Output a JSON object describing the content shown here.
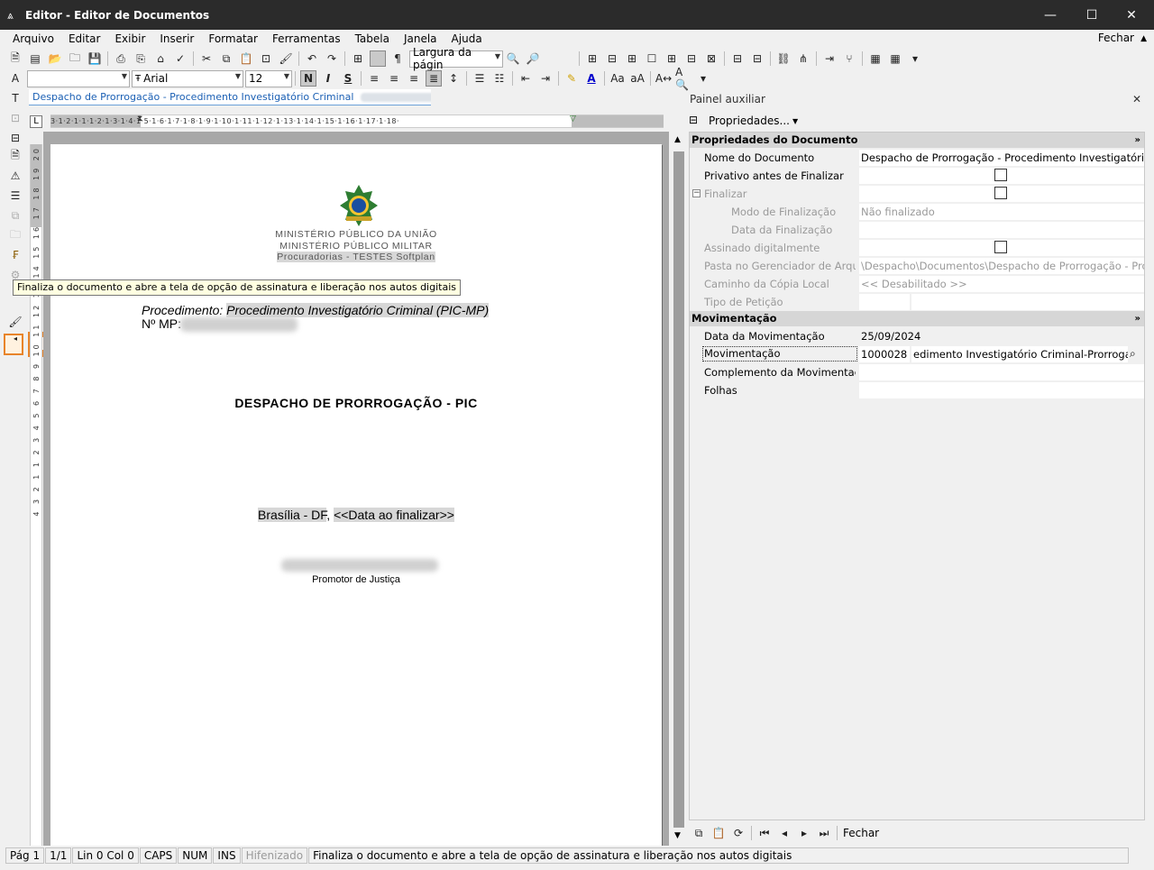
{
  "window": {
    "title": "Editor - Editor de Documentos"
  },
  "menu": {
    "items": [
      "Arquivo",
      "Editar",
      "Exibir",
      "Inserir",
      "Formatar",
      "Ferramentas",
      "Tabela",
      "Janela",
      "Ajuda"
    ],
    "close_label": "Fechar"
  },
  "toolbar": {
    "zoom_value": "Largura da págin",
    "style_value": "",
    "font_value": "Arial",
    "size_value": "12",
    "bold_label": "N",
    "italic_label": "I",
    "underline_label": "S"
  },
  "tab": {
    "label": "Despacho de Prorrogação - Procedimento Investigatório Criminal"
  },
  "ruler": {
    "horizontal": "3·1·2·1·1·1·2·1·3·1·4·1·5·1·6·1·7·1·8·1·9·1·10·1·11·1·12·1·13·1·14·1·15·1·16·1·17·1·18·",
    "vertical": "4 3 2 1 1 2 3 4 5 6 7 8 9 10 11 12 13 14 15 16 17 18 19 20"
  },
  "annotation": {
    "badge": "1",
    "tooltip": "Finaliza o documento e abre a tela de opção de assinatura e liberação nos autos digitais"
  },
  "document": {
    "header_line1": "MINISTÉRIO PÚBLICO DA UNIÃO",
    "header_line2": "MINISTÉRIO PÚBLICO MILITAR",
    "header_line3": "Procuradorias - TESTES Softplan",
    "proc_label": "Procedimento:",
    "proc_value": "Procedimento Investigatório Criminal (PIC-MP)",
    "mp_label": "Nº MP:",
    "title": "DESPACHO DE PRORROGAÇÃO - PIC",
    "place": "Brasília - DF",
    "place_sep": ", ",
    "date_field": "<<Data ao finalizar>>",
    "signer_role": "Promotor de Justiça"
  },
  "aux_panel": {
    "title": "Painel auxiliar",
    "properties_button": "Propriedades...",
    "section_doc": "Propriedades do Documento",
    "section_mov": "Movimentação",
    "rows": {
      "nome_label": "Nome do Documento",
      "nome_value": "Despacho de Prorrogação - Procedimento Investigatório Criminal",
      "privativo_label": "Privativo antes de Finalizar",
      "finalizar_label": "Finalizar",
      "modo_label": "Modo de Finalização",
      "modo_value": "Não finalizado",
      "data_fin_label": "Data da Finalização",
      "assinado_label": "Assinado digitalmente",
      "pasta_label": "Pasta no Gerenciador de Arquivos",
      "pasta_value": "\\Despacho\\Documentos\\Despacho de Prorrogação - Procedimento",
      "caminho_label": "Caminho da Cópia Local",
      "caminho_value": "<< Desabilitado >>",
      "tipo_label": "Tipo de Petição",
      "data_mov_label": "Data da Movimentação",
      "data_mov_value": "25/09/2024",
      "mov_label": "Movimentação",
      "mov_code": "1000028",
      "mov_desc": "edimento Investigatório Criminal-Prorrogação",
      "complemento_label": "Complemento da Movimentação",
      "folhas_label": "Folhas"
    },
    "bottom_close": "Fechar"
  },
  "status": {
    "page": "Pág 1",
    "pages": "1/1",
    "pos": "Lin 0  Col 0",
    "caps": "CAPS",
    "num": "NUM",
    "ins": "INS",
    "hyph": "Hifenizado",
    "message": "Finaliza o documento e abre a tela de opção de assinatura e liberação nos autos digitais"
  },
  "colors": {
    "accent": "#e8842a",
    "titlebar": "#2b2b2b",
    "tab_text": "#1a5fb4"
  }
}
